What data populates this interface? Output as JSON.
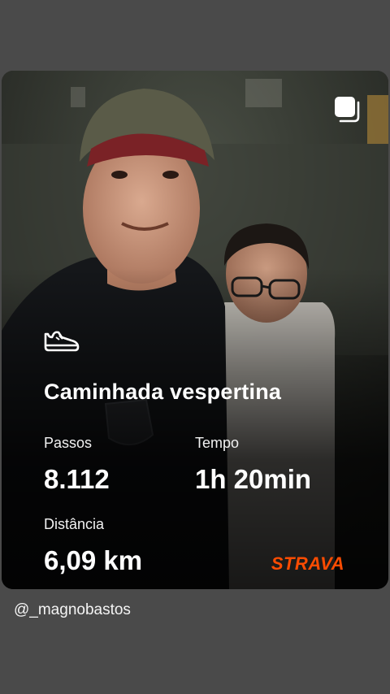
{
  "story": {
    "username": "@_magnobastos"
  },
  "activity": {
    "title": "Caminhada vespertina",
    "icon": "shoe-icon",
    "stats": {
      "steps_label": "Passos",
      "steps_value": "8.112",
      "time_label": "Tempo",
      "time_value": "1h 20min",
      "distance_label": "Distância",
      "distance_value": "6,09 km"
    },
    "brand": "STRAVA",
    "brand_color": "#fc4c02"
  },
  "icons": {
    "top_right": "multiple-photos-icon"
  }
}
